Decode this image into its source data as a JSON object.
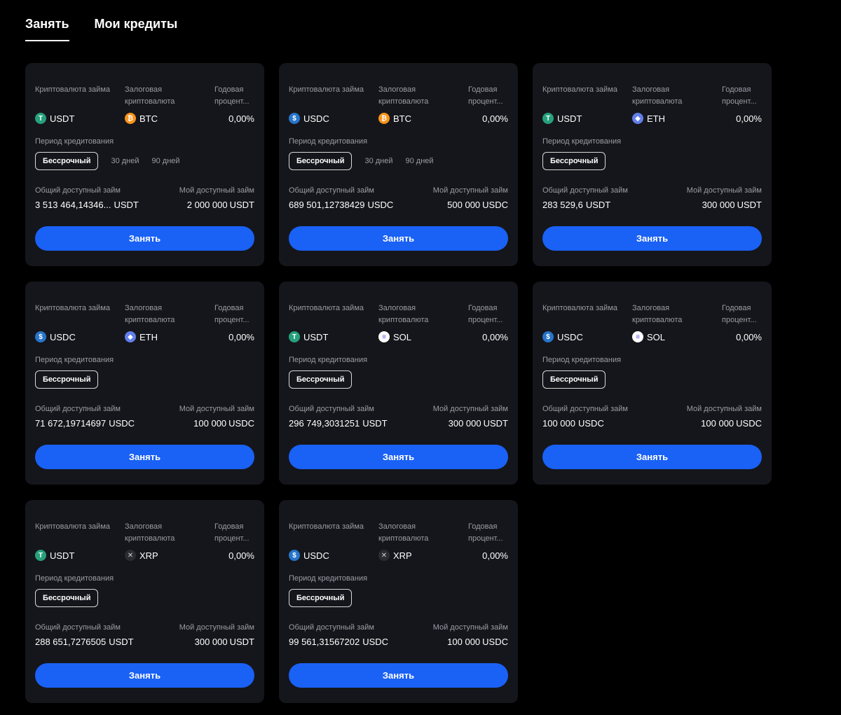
{
  "tabs": [
    {
      "label": "Занять",
      "active": true
    },
    {
      "label": "Мои кредиты",
      "active": false
    }
  ],
  "labels": {
    "loan_currency": "Криптовалюта займа",
    "collateral_line1": "Залоговая",
    "collateral_line2": "криптовалюта",
    "annual_line1": "Годовая",
    "annual_line2": "процент...",
    "period": "Период кредитования",
    "total_available": "Общий доступный займ",
    "my_available": "Мой доступный займ",
    "borrow_button": "Занять"
  },
  "cards": [
    {
      "loan": {
        "symbol": "USDT",
        "icon": "tether-icon"
      },
      "collateral": {
        "symbol": "BTC",
        "icon": "bitcoin-icon"
      },
      "rate": "0,00%",
      "periods": [
        "Бессрочный",
        "30 дней",
        "90 дней"
      ],
      "total": {
        "amount": "3 513 464,14346...",
        "unit": "USDT"
      },
      "mine": {
        "amount": "2 000 000",
        "unit": "USDT"
      }
    },
    {
      "loan": {
        "symbol": "USDC",
        "icon": "usdc-icon"
      },
      "collateral": {
        "symbol": "BTC",
        "icon": "bitcoin-icon"
      },
      "rate": "0,00%",
      "periods": [
        "Бессрочный",
        "30 дней",
        "90 дней"
      ],
      "total": {
        "amount": "689 501,12738429",
        "unit": "USDC"
      },
      "mine": {
        "amount": "500 000",
        "unit": "USDC"
      }
    },
    {
      "loan": {
        "symbol": "USDT",
        "icon": "tether-icon"
      },
      "collateral": {
        "symbol": "ETH",
        "icon": "ethereum-icon"
      },
      "rate": "0,00%",
      "periods": [
        "Бессрочный"
      ],
      "total": {
        "amount": "283 529,6",
        "unit": "USDT"
      },
      "mine": {
        "amount": "300 000",
        "unit": "USDT"
      }
    },
    {
      "loan": {
        "symbol": "USDC",
        "icon": "usdc-icon"
      },
      "collateral": {
        "symbol": "ETH",
        "icon": "ethereum-icon"
      },
      "rate": "0,00%",
      "periods": [
        "Бессрочный"
      ],
      "total": {
        "amount": "71 672,19714697",
        "unit": "USDC"
      },
      "mine": {
        "amount": "100 000",
        "unit": "USDC"
      }
    },
    {
      "loan": {
        "symbol": "USDT",
        "icon": "tether-icon"
      },
      "collateral": {
        "symbol": "SOL",
        "icon": "solana-icon"
      },
      "rate": "0,00%",
      "periods": [
        "Бессрочный"
      ],
      "total": {
        "amount": "296 749,3031251",
        "unit": "USDT"
      },
      "mine": {
        "amount": "300 000",
        "unit": "USDT"
      }
    },
    {
      "loan": {
        "symbol": "USDC",
        "icon": "usdc-icon"
      },
      "collateral": {
        "symbol": "SOL",
        "icon": "solana-icon"
      },
      "rate": "0,00%",
      "periods": [
        "Бессрочный"
      ],
      "total": {
        "amount": "100 000",
        "unit": "USDC"
      },
      "mine": {
        "amount": "100 000",
        "unit": "USDC"
      }
    },
    {
      "loan": {
        "symbol": "USDT",
        "icon": "tether-icon"
      },
      "collateral": {
        "symbol": "XRP",
        "icon": "xrp-icon"
      },
      "rate": "0,00%",
      "periods": [
        "Бессрочный"
      ],
      "total": {
        "amount": "288 651,7276505",
        "unit": "USDT"
      },
      "mine": {
        "amount": "300 000",
        "unit": "USDT"
      }
    },
    {
      "loan": {
        "symbol": "USDC",
        "icon": "usdc-icon"
      },
      "collateral": {
        "symbol": "XRP",
        "icon": "xrp-icon"
      },
      "rate": "0,00%",
      "periods": [
        "Бессрочный"
      ],
      "total": {
        "amount": "99 561,31567202",
        "unit": "USDC"
      },
      "mine": {
        "amount": "100 000",
        "unit": "USDC"
      }
    }
  ],
  "colors": {
    "background": "#000000",
    "card": "#15161b",
    "accent": "#1a61f5",
    "muted_text": "#9a9ca6"
  }
}
